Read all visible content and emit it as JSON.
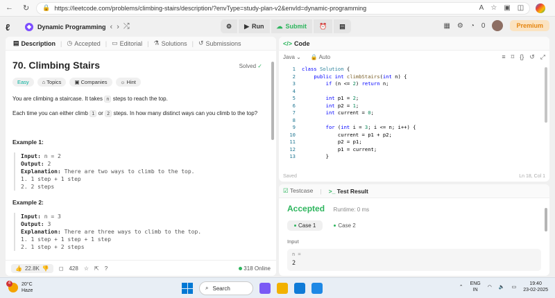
{
  "browser": {
    "url": "https://leetcode.com/problems/climbing-stairs/description/?envType=study-plan-v2&envId=dynamic-programming"
  },
  "topbar": {
    "problem_list": "Dynamic Programming",
    "run_label": "Run",
    "submit_label": "Submit",
    "notifications": "0",
    "premium_label": "Premium"
  },
  "left": {
    "tabs": [
      {
        "label": "Description"
      },
      {
        "label": "Accepted"
      },
      {
        "label": "Editorial"
      },
      {
        "label": "Solutions"
      },
      {
        "label": "Submissions"
      }
    ],
    "title": "70. Climbing Stairs",
    "solved": "Solved",
    "tags": [
      "Easy",
      "Topics",
      "Companies",
      "Hint"
    ],
    "desc": {
      "p1_a": "You are climbing a staircase. It takes",
      "p1_code": "n",
      "p1_b": "steps to reach the top.",
      "p2_a": "Each time you can either climb",
      "p2_code1": "1",
      "p2_mid": "or",
      "p2_code2": "2",
      "p2_b": "steps. In how many distinct ways can you climb to the top?"
    },
    "examples": [
      {
        "title": "Example 1:",
        "input_label": "Input:",
        "input": "n = 2",
        "output_label": "Output:",
        "output": "2",
        "expl_label": "Explanation:",
        "expl": "There are two ways to climb to the top.",
        "steps": [
          "1. 1 step + 1 step",
          "2. 2 steps"
        ]
      },
      {
        "title": "Example 2:",
        "input_label": "Input:",
        "input": "n = 3",
        "output_label": "Output:",
        "output": "3",
        "expl_label": "Explanation:",
        "expl": "There are three ways to climb to the top.",
        "steps": [
          "1. 1 step + 1 step + 1 step",
          "2. 1 step + 2 steps"
        ]
      }
    ],
    "footer": {
      "likes": "22.8K",
      "comments": "428",
      "online": "318 Online"
    }
  },
  "code": {
    "header": "Code",
    "language": "Java",
    "mode": "Auto",
    "status": "Saved",
    "cursor": "Ln 18, Col 1",
    "lines": [
      {
        "n": "1",
        "text": "class Solution {"
      },
      {
        "n": "2",
        "text": "    public int climbStairs(int n) {"
      },
      {
        "n": "3",
        "text": "        if (n <= 2) return n;"
      },
      {
        "n": "4",
        "text": ""
      },
      {
        "n": "5",
        "text": "        int p1 = 2;"
      },
      {
        "n": "6",
        "text": "        int p2 = 1;"
      },
      {
        "n": "7",
        "text": "        int current = 0;"
      },
      {
        "n": "8",
        "text": ""
      },
      {
        "n": "9",
        "text": "        for (int i = 3; i <= n; i++) {"
      },
      {
        "n": "10",
        "text": "            current = p1 + p2;"
      },
      {
        "n": "11",
        "text": "            p2 = p1;"
      },
      {
        "n": "12",
        "text": "            p1 = current;"
      },
      {
        "n": "13",
        "text": "        }"
      }
    ]
  },
  "result": {
    "tab_testcase": "Testcase",
    "tab_result": "Test Result",
    "status": "Accepted",
    "runtime": "Runtime: 0 ms",
    "cases": [
      "Case 1",
      "Case 2"
    ],
    "input_label": "Input",
    "var_name": "n =",
    "var_value": "2"
  },
  "taskbar": {
    "temp": "20°C",
    "weather": "Haze",
    "weather_badge": "4",
    "search": "Search",
    "lang1": "ENG",
    "lang2": "IN",
    "time": "19:40",
    "date": "23-02-2025"
  }
}
